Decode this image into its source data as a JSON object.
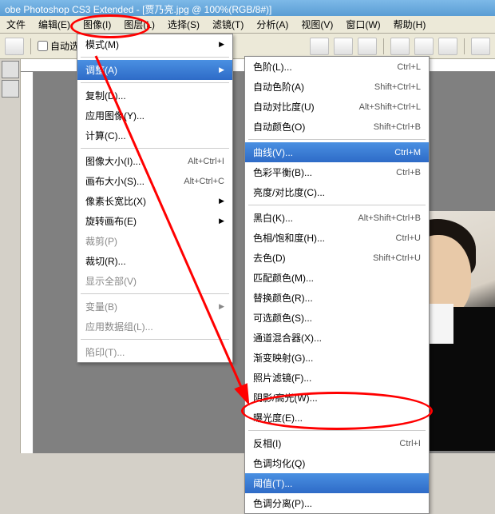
{
  "title": "obe Photoshop CS3 Extended - [贾乃亮.jpg @ 100%(RGB/8#)]",
  "menubar": {
    "file": "文件",
    "edit": "编辑(E)",
    "image": "图像(I)",
    "layer": "图层(L)",
    "select": "选择(S)",
    "filter": "滤镜(T)",
    "analyze": "分析(A)",
    "view": "视图(V)",
    "window": "窗口(W)",
    "help": "帮助(H)"
  },
  "toolbar": {
    "auto_select": "自动选择:"
  },
  "dd1": {
    "mode": "模式(M)",
    "adjust": "调整(A)",
    "duplicate": "复制(D)...",
    "apply_image": "应用图像(Y)...",
    "calc": "计算(C)...",
    "image_size": "图像大小(I)...",
    "image_size_sc": "Alt+Ctrl+I",
    "canvas_size": "画布大小(S)...",
    "canvas_size_sc": "Alt+Ctrl+C",
    "pixel_aspect": "像素长宽比(X)",
    "rotate_canvas": "旋转画布(E)",
    "crop": "裁剪(P)",
    "trim_r": "裁切(R)...",
    "reveal_all": "显示全部(V)",
    "variables": "变量(B)",
    "apply_dataset": "应用数据组(L)...",
    "trap": "陷印(T)..."
  },
  "dd2": {
    "levels": "色阶(L)...",
    "levels_sc": "Ctrl+L",
    "auto_levels": "自动色阶(A)",
    "auto_levels_sc": "Shift+Ctrl+L",
    "auto_contrast": "自动对比度(U)",
    "auto_contrast_sc": "Alt+Shift+Ctrl+L",
    "auto_color": "自动颜色(O)",
    "auto_color_sc": "Shift+Ctrl+B",
    "curves": "曲线(V)...",
    "curves_sc": "Ctrl+M",
    "color_balance": "色彩平衡(B)...",
    "color_balance_sc": "Ctrl+B",
    "bright_contrast": "亮度/对比度(C)...",
    "bw": "黑白(K)...",
    "bw_sc": "Alt+Shift+Ctrl+B",
    "hue_sat": "色相/饱和度(H)...",
    "hue_sat_sc": "Ctrl+U",
    "desat": "去色(D)",
    "desat_sc": "Shift+Ctrl+U",
    "match_color": "匹配颜色(M)...",
    "replace_color": "替换颜色(R)...",
    "selective_color": "可选颜色(S)...",
    "channel_mixer": "通道混合器(X)...",
    "grad_map": "渐变映射(G)...",
    "photo_filter": "照片滤镜(F)...",
    "shadow_highlight": "阴影/高光(W)...",
    "exposure": "曝光度(E)...",
    "invert": "反相(I)",
    "invert_sc": "Ctrl+I",
    "equalize": "色调均化(Q)",
    "threshold": "阈值(T)...",
    "posterize": "色调分离(P)..."
  }
}
